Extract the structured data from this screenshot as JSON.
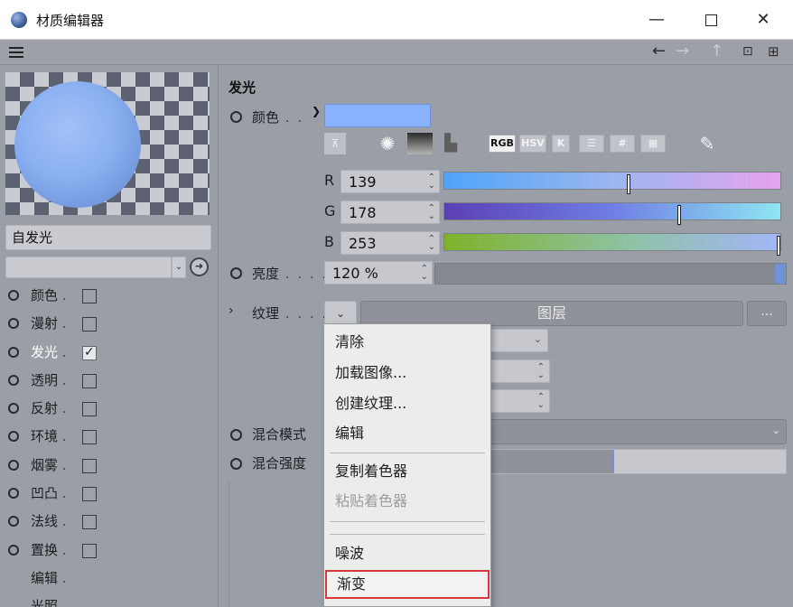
{
  "window": {
    "title": "材质编辑器",
    "min": "—",
    "close": "✕"
  },
  "toolbar": {
    "back": "←",
    "forward": "→",
    "up": "↑",
    "lock": "🔒",
    "newwin": "⊞"
  },
  "material": {
    "name": "自发光"
  },
  "channels": [
    {
      "label": "颜色",
      "checked": false
    },
    {
      "label": "漫射",
      "checked": false
    },
    {
      "label": "发光",
      "checked": true
    },
    {
      "label": "透明",
      "checked": false
    },
    {
      "label": "反射",
      "checked": false
    },
    {
      "label": "环境",
      "checked": false
    },
    {
      "label": "烟雾",
      "checked": false
    },
    {
      "label": "凹凸",
      "checked": false
    },
    {
      "label": "法线",
      "checked": false
    },
    {
      "label": "置换",
      "checked": false
    },
    {
      "label": "编辑"
    },
    {
      "label": "光照"
    }
  ],
  "luminance": {
    "section_title": "发光",
    "color_label": "颜色",
    "color_hex": "#8bb2fd",
    "modes": {
      "rgb": "RGB",
      "hsv": "HSV",
      "k": "K"
    },
    "r_label": "R",
    "r_value": "139",
    "g_label": "G",
    "g_value": "178",
    "b_label": "B",
    "b_value": "253",
    "brightness_label": "亮度",
    "brightness_value": "120 %",
    "texture_label": "纹理",
    "layer_label": "图层",
    "more": "...",
    "mix_mode_label": "混合模式",
    "mix_strength_label": "混合强度"
  },
  "context_menu": {
    "clear": "清除",
    "load_image": "加载图像...",
    "create_texture": "创建纹理...",
    "edit": "编辑",
    "copy_shader": "复制着色器",
    "paste_shader": "粘贴着色器",
    "noise": "噪波",
    "gradient": "渐变"
  }
}
